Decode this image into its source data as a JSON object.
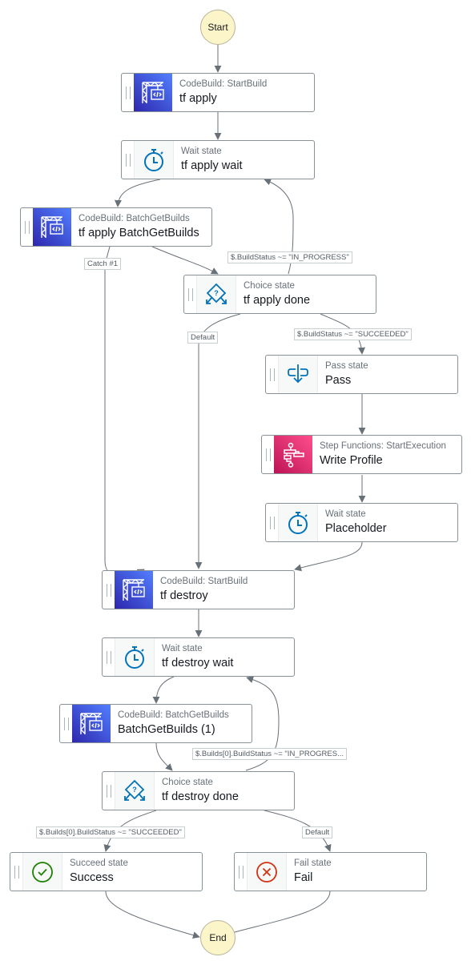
{
  "diagram": {
    "start": {
      "label": "Start"
    },
    "end": {
      "label": "End"
    },
    "nodes": [
      {
        "id": "tf-apply",
        "type": "CodeBuild: StartBuild",
        "name": "tf apply",
        "icon": "codebuild-icon"
      },
      {
        "id": "tf-apply-wait",
        "type": "Wait state",
        "name": "tf apply wait",
        "icon": "stopwatch-icon"
      },
      {
        "id": "tf-apply-batch",
        "type": "CodeBuild: BatchGetBuilds",
        "name": "tf apply BatchGetBuilds",
        "icon": "codebuild-icon"
      },
      {
        "id": "tf-apply-done",
        "type": "Choice state",
        "name": "tf apply done",
        "icon": "choice-icon"
      },
      {
        "id": "pass",
        "type": "Pass state",
        "name": "Pass",
        "icon": "pass-icon"
      },
      {
        "id": "write-profile",
        "type": "Step Functions: StartExecution",
        "name": "Write Profile",
        "icon": "step-functions-icon"
      },
      {
        "id": "placeholder",
        "type": "Wait state",
        "name": "Placeholder",
        "icon": "stopwatch-icon"
      },
      {
        "id": "tf-destroy",
        "type": "CodeBuild: StartBuild",
        "name": "tf destroy",
        "icon": "codebuild-icon"
      },
      {
        "id": "tf-destroy-wait",
        "type": "Wait state",
        "name": "tf destroy wait",
        "icon": "stopwatch-icon"
      },
      {
        "id": "batch-1",
        "type": "CodeBuild: BatchGetBuilds",
        "name": "BatchGetBuilds (1)",
        "icon": "codebuild-icon"
      },
      {
        "id": "tf-destroy-done",
        "type": "Choice state",
        "name": "tf destroy done",
        "icon": "choice-icon"
      },
      {
        "id": "success",
        "type": "Succeed state",
        "name": "Success",
        "icon": "check-circle-icon"
      },
      {
        "id": "fail",
        "type": "Fail state",
        "name": "Fail",
        "icon": "x-circle-icon"
      }
    ],
    "edge_labels": [
      {
        "id": "catch-1",
        "text": "Catch #1"
      },
      {
        "id": "apply-in-progress",
        "text": "$.BuildStatus ~= \"IN_PROGRESS\""
      },
      {
        "id": "apply-default",
        "text": "Default"
      },
      {
        "id": "apply-succeeded",
        "text": "$.BuildStatus ~= \"SUCCEEDED\""
      },
      {
        "id": "destroy-in-progress",
        "text": "$.Builds[0].BuildStatus ~= \"IN_PROGRES..."
      },
      {
        "id": "destroy-succeeded",
        "text": "$.Builds[0].BuildStatus ~= \"SUCCEEDED\""
      },
      {
        "id": "destroy-default",
        "text": "Default"
      }
    ],
    "colors": {
      "edge": "#687078",
      "terminal_fill": "#fcf5c9",
      "codebuild_from": "#2e27ad",
      "codebuild_to": "#527fff",
      "stepfn_from": "#bc1356",
      "stepfn_to": "#ff4f8b",
      "state_icon": "#0073bb",
      "success": "#1d8102",
      "fail": "#d13212"
    }
  }
}
